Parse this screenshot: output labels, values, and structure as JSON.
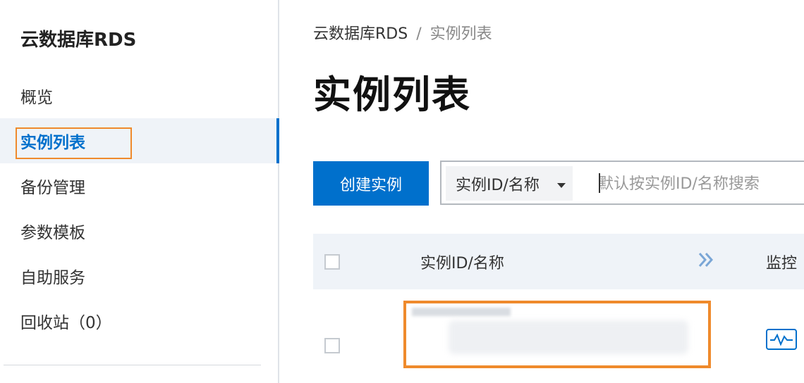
{
  "sidebar": {
    "title": "云数据库RDS",
    "items": [
      {
        "label": "概览"
      },
      {
        "label": "实例列表"
      },
      {
        "label": "备份管理"
      },
      {
        "label": "参数模板"
      },
      {
        "label": "自助服务"
      },
      {
        "label": "回收站（0）"
      }
    ],
    "active_index": 1
  },
  "breadcrumb": {
    "root": "云数据库RDS",
    "separator": "/",
    "current": "实例列表"
  },
  "page": {
    "title": "实例列表"
  },
  "toolbar": {
    "create_label": "创建实例",
    "search_select": "实例ID/名称",
    "search_placeholder": "默认按实例ID/名称搜索"
  },
  "table": {
    "columns": [
      "实例ID/名称",
      "监控"
    ],
    "expand_icon": "double-chevron-right-icon",
    "rows": [
      {
        "name": "",
        "monitor_icon": "monitor-chart-icon"
      }
    ]
  },
  "colors": {
    "accent": "#0070cc",
    "highlight": "#ef8a2c"
  }
}
